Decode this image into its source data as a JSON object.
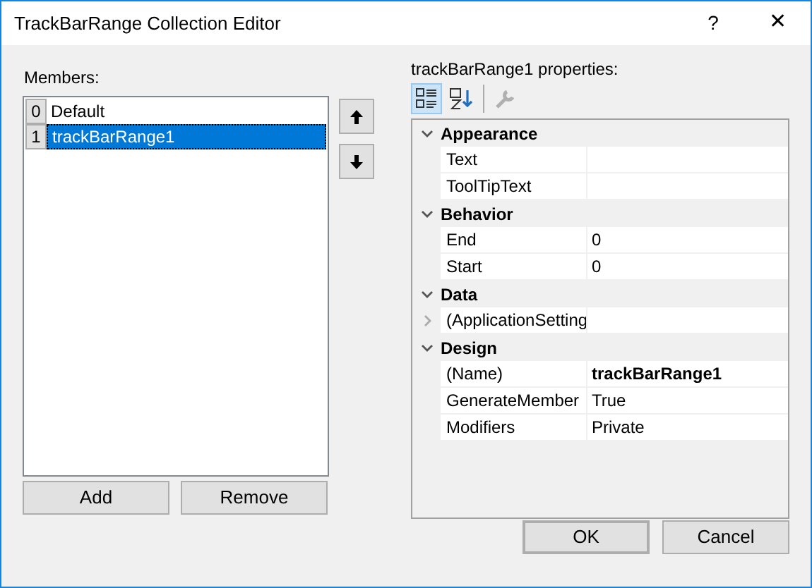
{
  "window": {
    "title": "TrackBarRange Collection Editor",
    "help": "?",
    "close": "✕"
  },
  "members": {
    "label": "Members:",
    "items": [
      {
        "index": "0",
        "name": "Default",
        "selected": false
      },
      {
        "index": "1",
        "name": "trackBarRange1",
        "selected": true
      }
    ]
  },
  "properties": {
    "label": "trackBarRange1 properties:",
    "toolbar": [
      {
        "kind": "categorized",
        "selected": true
      },
      {
        "kind": "alphabetical",
        "selected": false
      },
      {
        "kind": "property-pages",
        "selected": false,
        "disabled": true
      }
    ],
    "categories": [
      {
        "name": "Appearance",
        "expanded": true,
        "rows": [
          {
            "name": "Text"
          },
          {
            "name": "ToolTipText"
          }
        ]
      },
      {
        "name": "Behavior",
        "expanded": true,
        "rows": [
          {
            "name": "End",
            "value": "0"
          },
          {
            "name": "Start",
            "value": "0"
          }
        ]
      },
      {
        "name": "Data",
        "expanded": true,
        "rows": [
          {
            "name": "(ApplicationSetting",
            "expanded": false
          }
        ]
      },
      {
        "name": "Design",
        "expanded": true,
        "rows": [
          {
            "name": "(Name)",
            "value": "trackBarRange1",
            "bold": true
          },
          {
            "name": "GenerateMember",
            "value": "True"
          },
          {
            "name": "Modifiers",
            "value": "Private"
          }
        ]
      }
    ]
  },
  "buttons": {
    "add": "Add",
    "remove": "Remove",
    "ok": "OK",
    "cancel": "Cancel"
  }
}
